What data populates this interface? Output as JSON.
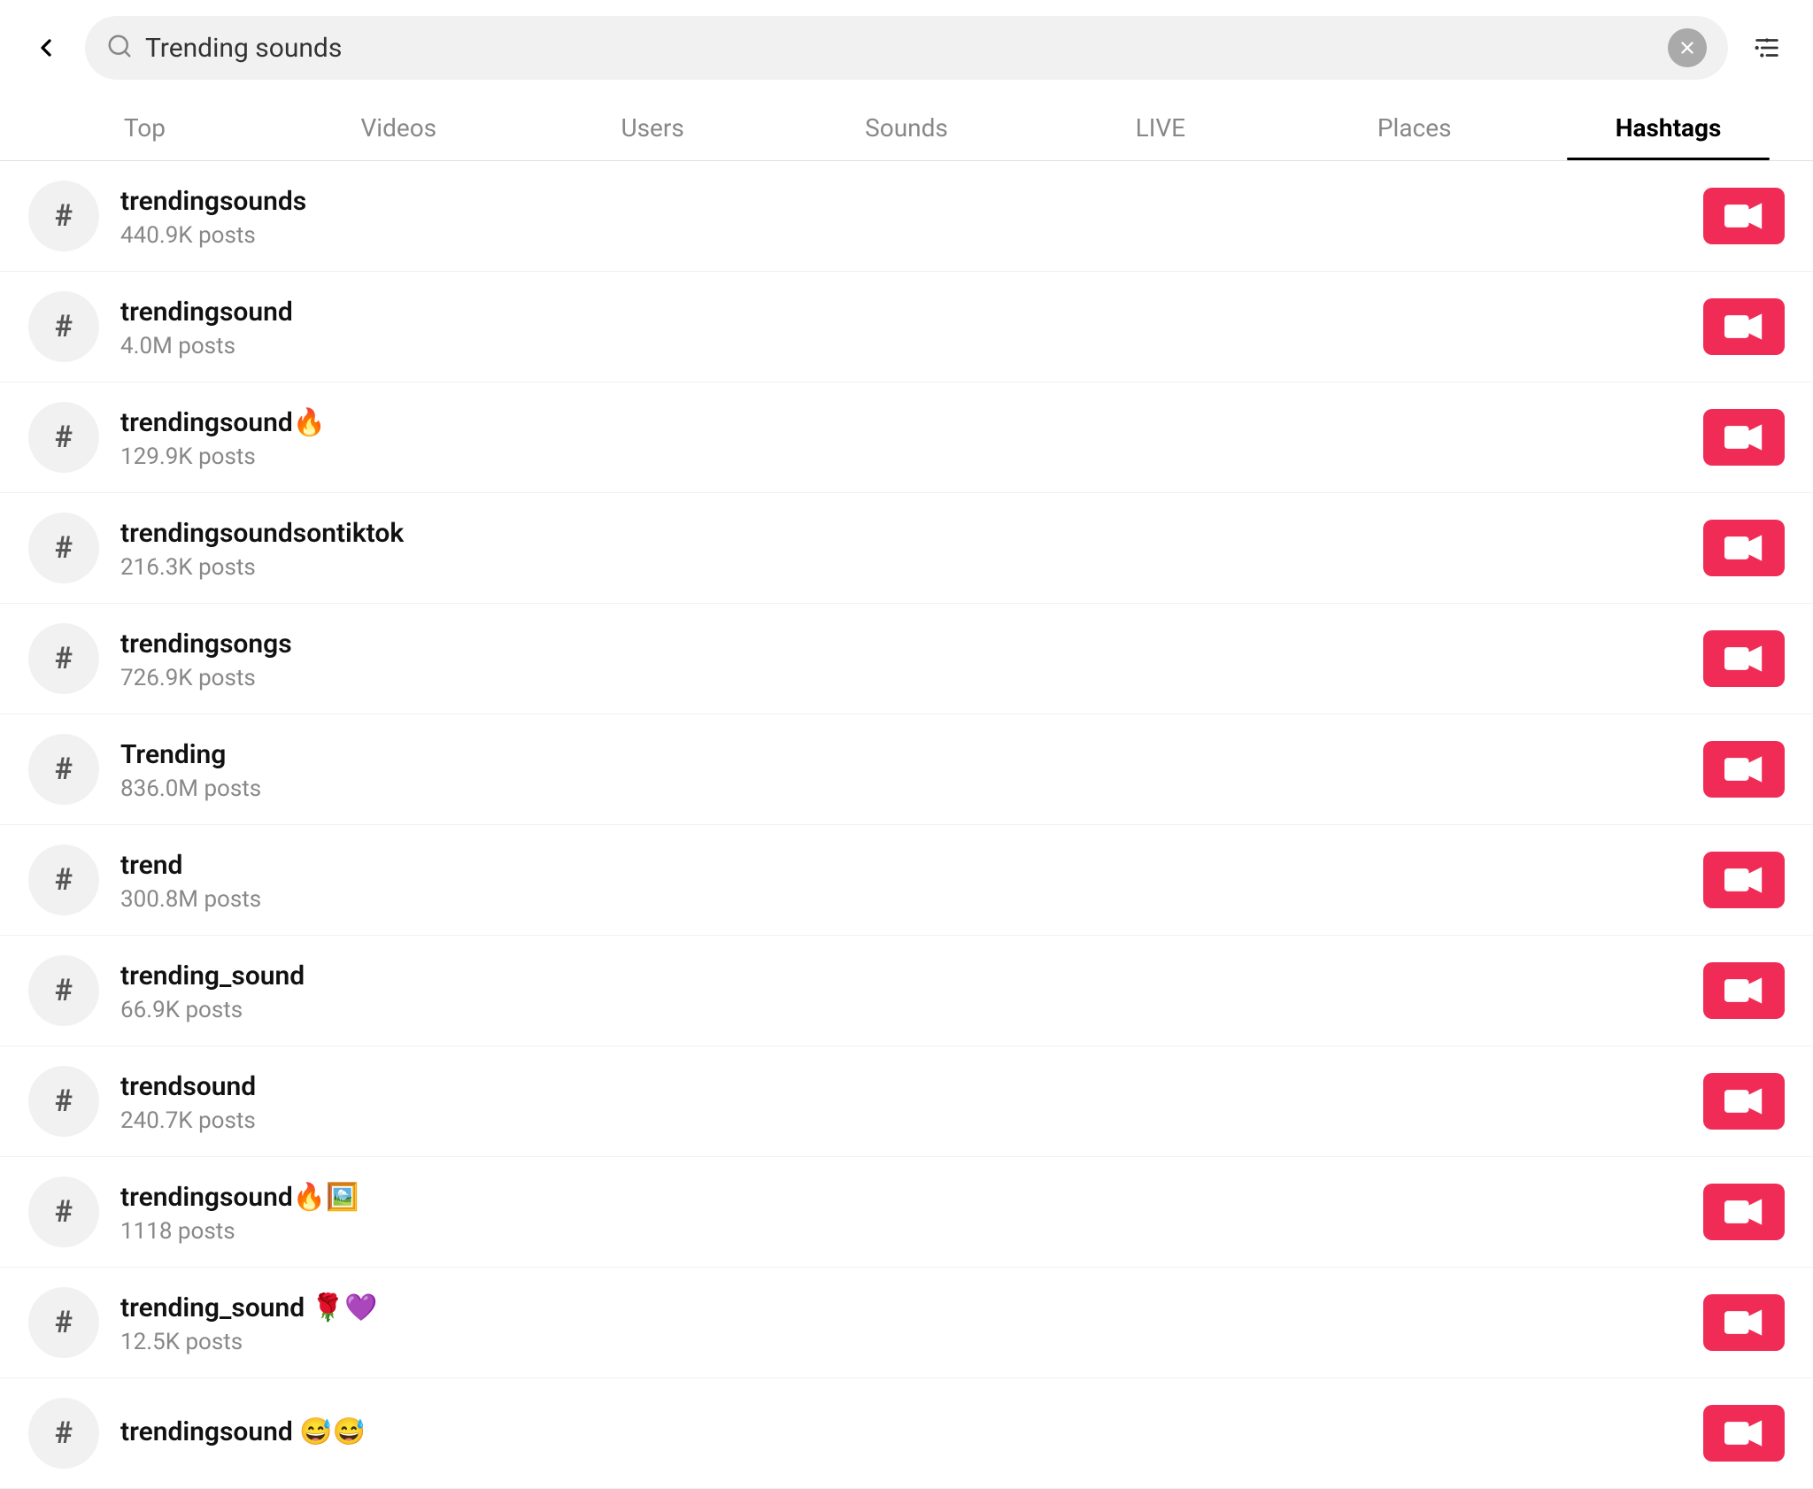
{
  "search": {
    "placeholder": "Trending sounds",
    "value": "Trending sounds"
  },
  "tabs": [
    {
      "id": "top",
      "label": "Top",
      "active": false
    },
    {
      "id": "videos",
      "label": "Videos",
      "active": false
    },
    {
      "id": "users",
      "label": "Users",
      "active": false
    },
    {
      "id": "sounds",
      "label": "Sounds",
      "active": false
    },
    {
      "id": "live",
      "label": "LIVE",
      "active": false
    },
    {
      "id": "places",
      "label": "Places",
      "active": false
    },
    {
      "id": "hashtags",
      "label": "Hashtags",
      "active": true
    }
  ],
  "results": [
    {
      "id": 1,
      "title": "trendingsounds",
      "subtitle": "440.9K posts"
    },
    {
      "id": 2,
      "title": "trendingsound",
      "subtitle": "4.0M posts"
    },
    {
      "id": 3,
      "title": "trendingsound🔥",
      "subtitle": "129.9K posts"
    },
    {
      "id": 4,
      "title": "trendingsoundsontiktok",
      "subtitle": "216.3K posts"
    },
    {
      "id": 5,
      "title": "trendingsongs",
      "subtitle": "726.9K posts"
    },
    {
      "id": 6,
      "title": "Trending",
      "subtitle": "836.0M posts"
    },
    {
      "id": 7,
      "title": "trend",
      "subtitle": "300.8M posts"
    },
    {
      "id": 8,
      "title": "trending_sound",
      "subtitle": "66.9K posts"
    },
    {
      "id": 9,
      "title": "trendsound",
      "subtitle": "240.7K posts"
    },
    {
      "id": 10,
      "title": "trendingsound🔥🖼️",
      "subtitle": "1118 posts"
    },
    {
      "id": 11,
      "title": "trending_sound 🌹💜",
      "subtitle": "12.5K posts"
    },
    {
      "id": 12,
      "title": "trendingsound 😅😅",
      "subtitle": ""
    }
  ],
  "icons": {
    "hashtag": "#",
    "back_arrow": "←",
    "search": "🔍",
    "clear": "✕",
    "filter": "⚙",
    "video_camera": "📹"
  },
  "colors": {
    "accent": "#f02c56",
    "active_tab_border": "#000",
    "search_bg": "#f1f1f2",
    "icon_bg": "#f1f1f2"
  }
}
